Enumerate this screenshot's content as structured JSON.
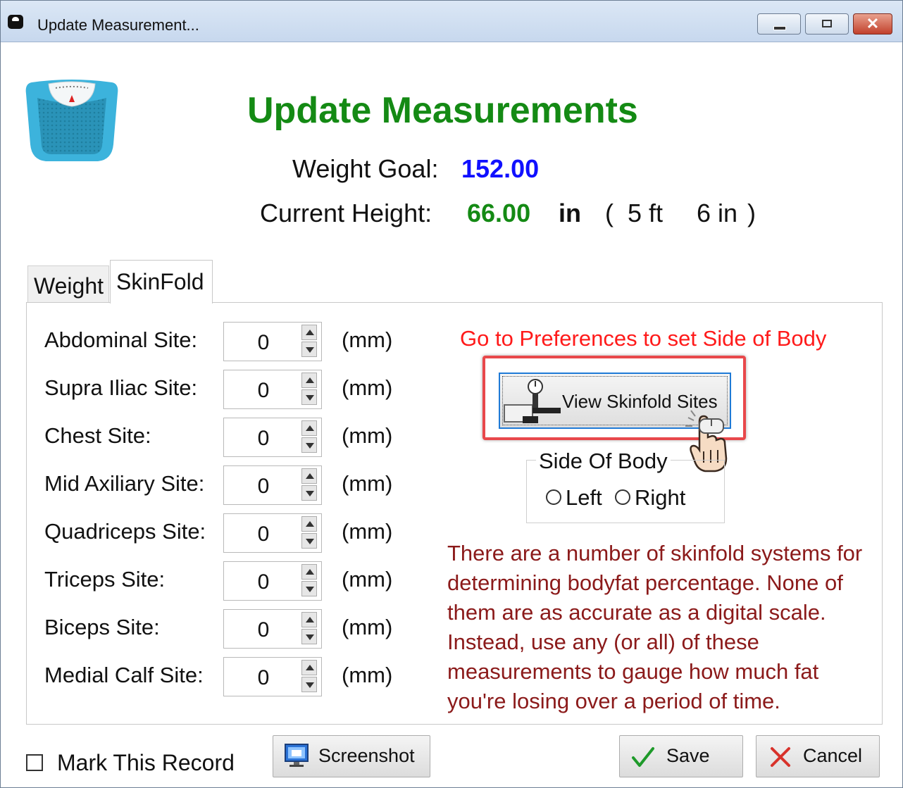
{
  "window": {
    "title": "Update Measurement...",
    "close_glyph": "✕"
  },
  "header": {
    "title": "Update Measurements",
    "weight_goal_label": "Weight Goal:",
    "weight_goal_value": "152.00",
    "height_label": "Current Height:",
    "height_value": "66.00",
    "height_unit": "in",
    "paren_open": "(",
    "height_ft": "5 ft",
    "height_in": "6 in",
    "paren_close": ")"
  },
  "tabs": [
    {
      "label": "Weight",
      "active": false
    },
    {
      "label": "SkinFold",
      "active": true
    }
  ],
  "sites": [
    {
      "label": "Abdominal Site:",
      "value": "0",
      "unit": "(mm)"
    },
    {
      "label": "Supra Iliac Site:",
      "value": "0",
      "unit": "(mm)"
    },
    {
      "label": "Chest Site:",
      "value": "0",
      "unit": "(mm)"
    },
    {
      "label": "Mid Axiliary Site:",
      "value": "0",
      "unit": "(mm)"
    },
    {
      "label": "Quadriceps Site:",
      "value": "0",
      "unit": "(mm)"
    },
    {
      "label": "Triceps Site:",
      "value": "0",
      "unit": "(mm)"
    },
    {
      "label": "Biceps Site:",
      "value": "0",
      "unit": "(mm)"
    },
    {
      "label": "Medial Calf Site:",
      "value": "0",
      "unit": "(mm)"
    }
  ],
  "skinfold": {
    "preferences_note": "Go to Preferences to set Side of Body",
    "view_button_label": "View Skinfold Sites",
    "side_group_title": "Side Of Body",
    "side_left": "Left",
    "side_right": "Right",
    "info": "There are a number of skinfold systems for determining bodyfat percentage. None of them are as accurate as a digital scale. Instead, use any (or all) of these measurements to gauge how much fat you're losing over a period of time."
  },
  "footer": {
    "mark_record_label": "Mark This Record",
    "screenshot_label": "Screenshot",
    "save_label": "Save",
    "cancel_label": "Cancel"
  },
  "colors": {
    "title_green": "#148a14",
    "goal_blue": "#1010ff",
    "note_red": "#ff1a1a",
    "info_maroon": "#8b1a1a",
    "highlight_red": "#e8484b"
  },
  "icons": [
    "scale-icon",
    "caliper-icon",
    "hand-cursor-icon",
    "screenshot-icon",
    "checkmark-icon",
    "x-icon"
  ]
}
